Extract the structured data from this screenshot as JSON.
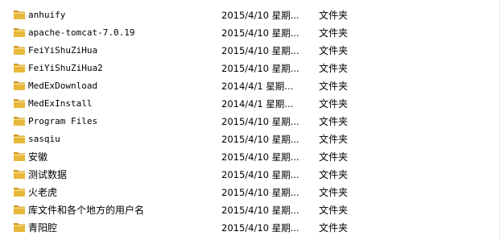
{
  "files": [
    {
      "name": "anhuify",
      "date": "2015/4/10 星期...",
      "type": "文件夹",
      "icon": "folder-icon"
    },
    {
      "name": "apache-tomcat-7.0.19",
      "date": "2015/4/10 星期...",
      "type": "文件夹",
      "icon": "folder-icon"
    },
    {
      "name": "FeiYiShuZiHua",
      "date": "2015/4/10 星期...",
      "type": "文件夹",
      "icon": "folder-icon"
    },
    {
      "name": "FeiYiShuZiHua2",
      "date": "2015/4/10 星期...",
      "type": "文件夹",
      "icon": "folder-icon"
    },
    {
      "name": "MedExDownload",
      "date": "2014/4/1 星期...",
      "type": "文件夹",
      "icon": "folder-icon"
    },
    {
      "name": "MedExInstall",
      "date": "2014/4/1 星期...",
      "type": "文件夹",
      "icon": "folder-icon"
    },
    {
      "name": "Program Files",
      "date": "2015/4/10 星期...",
      "type": "文件夹",
      "icon": "folder-icon"
    },
    {
      "name": "sasqiu",
      "date": "2015/4/10 星期...",
      "type": "文件夹",
      "icon": "folder-icon"
    },
    {
      "name": "安徽",
      "date": "2015/4/10 星期...",
      "type": "文件夹",
      "icon": "folder-icon"
    },
    {
      "name": "测试数据",
      "date": "2015/4/10 星期...",
      "type": "文件夹",
      "icon": "folder-icon"
    },
    {
      "name": "火老虎",
      "date": "2015/4/10 星期...",
      "type": "文件夹",
      "icon": "folder-icon"
    },
    {
      "name": "库文件和各个地方的用户名",
      "date": "2015/4/10 星期...",
      "type": "文件夹",
      "icon": "folder-icon"
    },
    {
      "name": "青阳腔",
      "date": "2015/4/10 星期...",
      "type": "文件夹",
      "icon": "folder-icon"
    }
  ],
  "colors": {
    "folder_front": "#e8b83a",
    "folder_back": "#d29a1e",
    "folder_highlight": "#f7dc8a",
    "row_hover": "#e5f3fb"
  }
}
